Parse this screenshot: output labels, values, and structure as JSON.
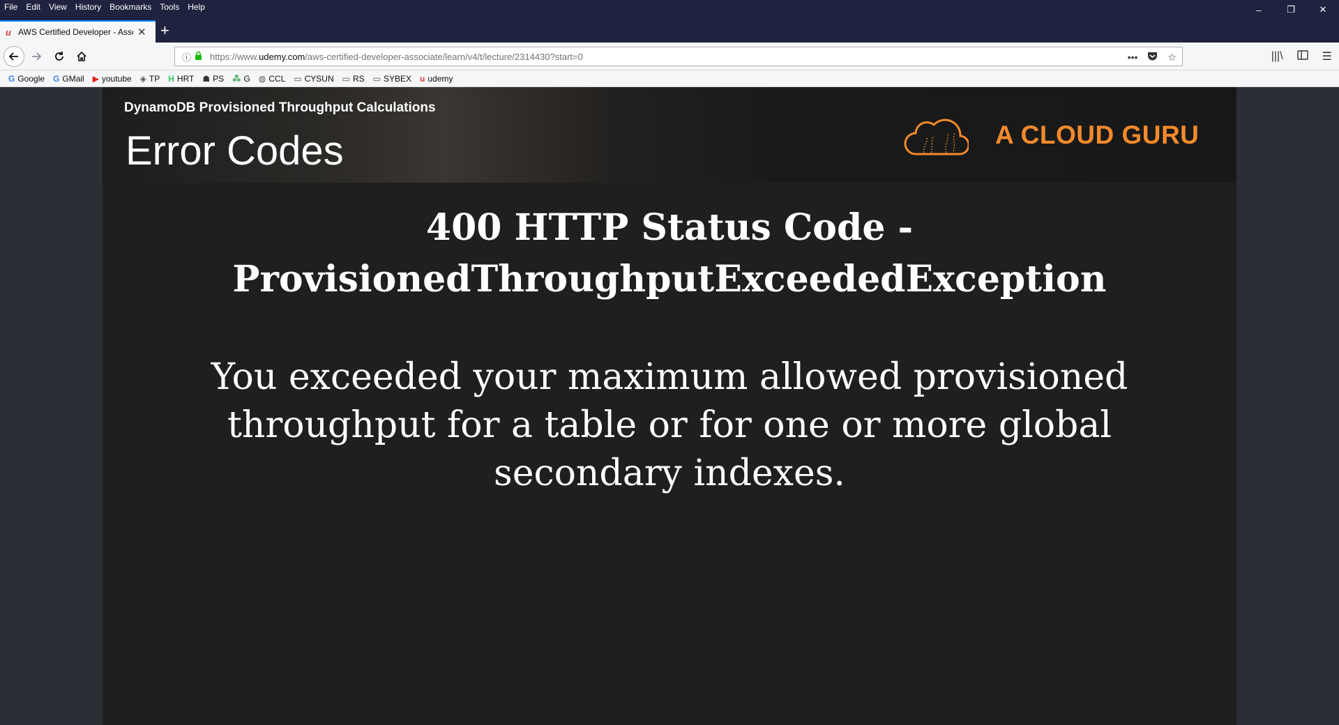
{
  "menu": [
    "File",
    "Edit",
    "View",
    "History",
    "Bookmarks",
    "Tools",
    "Help"
  ],
  "window_controls": {
    "minimize": "–",
    "restore": "❐",
    "close": "✕"
  },
  "tab": {
    "title": "AWS Certified Developer - Associate",
    "favicon": "udemy-icon"
  },
  "url": {
    "prefix": "https://www.",
    "domain": "udemy.com",
    "path": "/aws-certified-developer-associate/learn/v4/t/lecture/2314430?start=0"
  },
  "bookmarks": [
    {
      "label": "Google",
      "icon": "G",
      "color": "#4285f4"
    },
    {
      "label": "GMail",
      "icon": "G",
      "color": "#4285f4"
    },
    {
      "label": "youtube",
      "icon": "▶",
      "color": "#e62117"
    },
    {
      "label": "TP",
      "icon": "◈",
      "color": "#555555"
    },
    {
      "label": "HRT",
      "icon": "H",
      "color": "#2ec866"
    },
    {
      "label": "PS",
      "icon": "☗",
      "color": "#333333"
    },
    {
      "label": "G",
      "icon": "⁂",
      "color": "#2d9d4a"
    },
    {
      "label": "CCL",
      "icon": "◍",
      "color": "#555555"
    },
    {
      "label": "CYSUN",
      "icon": "▭",
      "color": "#555555"
    },
    {
      "label": "RS",
      "icon": "▭",
      "color": "#555555"
    },
    {
      "label": "SYBEX",
      "icon": "▭",
      "color": "#555555"
    },
    {
      "label": "udemy",
      "icon": "u",
      "color": "#e03a3a"
    }
  ],
  "slide": {
    "section": "DynamoDB Provisioned Throughput Calculations",
    "title": "Error Codes",
    "brand": "A CLOUD GURU",
    "heading_line1": "400 HTTP Status Code -",
    "heading_line2": "ProvisionedThroughputExceededException",
    "body": "You exceeded your maximum allowed provisioned throughput for a table or for one or more global secondary indexes."
  },
  "colors": {
    "brand": "#f28a2c",
    "chrome": "#202340",
    "slide_bg": "#1f1f1f"
  }
}
